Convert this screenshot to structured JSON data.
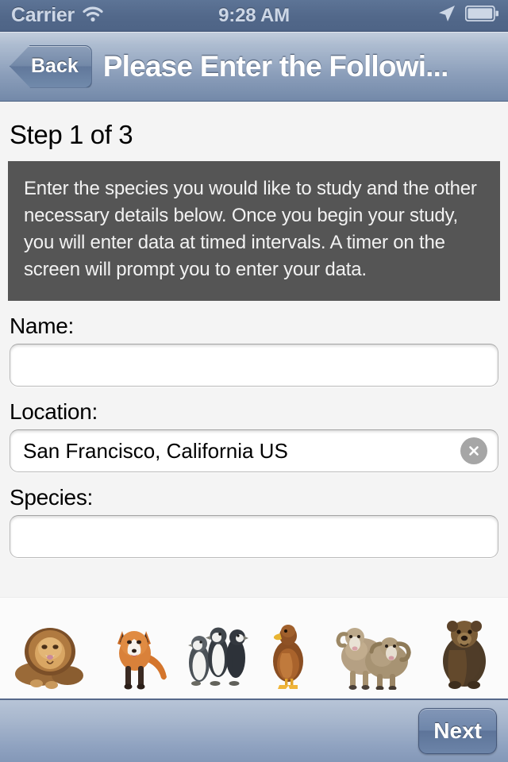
{
  "status_bar": {
    "carrier": "Carrier",
    "time": "9:28 AM",
    "wifi_icon": "wifi-icon",
    "location_icon": "location-arrow-icon",
    "battery_icon": "battery-icon"
  },
  "nav_bar": {
    "back_label": "Back",
    "title": "Please Enter the Followi..."
  },
  "main": {
    "step_title": "Step 1 of 3",
    "instructions": "Enter the species you would like to study and the other necessary details below. Once you begin your study, you will enter data at timed intervals.  A timer on the screen will prompt you to enter your data.",
    "fields": [
      {
        "label": "Name:",
        "value": "",
        "placeholder": ""
      },
      {
        "label": "Location:",
        "value": "San Francisco, California US",
        "placeholder": ""
      },
      {
        "label": "Species:",
        "value": "",
        "placeholder": ""
      }
    ],
    "clear_icon": "clear-circle-icon"
  },
  "animals": [
    {
      "name": "lion"
    },
    {
      "name": "fox"
    },
    {
      "name": "penguins"
    },
    {
      "name": "duck"
    },
    {
      "name": "sheep"
    },
    {
      "name": "bear"
    }
  ],
  "toolbar": {
    "next_label": "Next"
  },
  "colors": {
    "status_bar": "#52688a",
    "nav_bar": "#8b9eba",
    "page_background": "#f4f4f4",
    "instruction_box": "#555555",
    "toolbar": "#8fa2c0",
    "clear_button": "#a6a6a6"
  }
}
